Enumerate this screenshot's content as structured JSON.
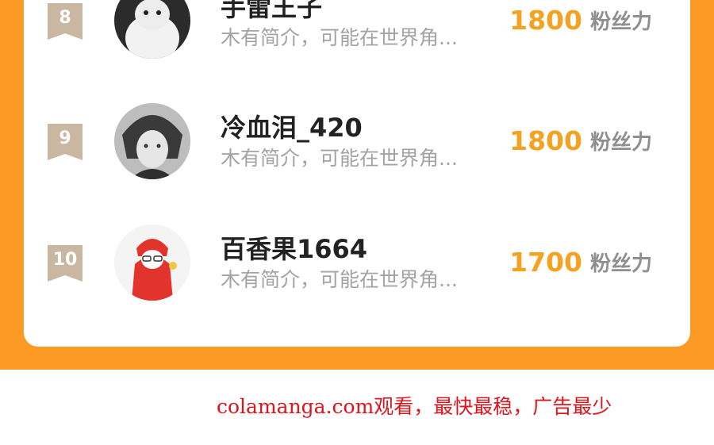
{
  "rows": [
    {
      "rank": "8",
      "username": "手雷王子",
      "bio": "木有简介，可能在世界角...",
      "fans": "1800",
      "fans_unit": "粉丝力"
    },
    {
      "rank": "9",
      "username": "冷血泪_420",
      "bio": "木有简介，可能在世界角...",
      "fans": "1800",
      "fans_unit": "粉丝力"
    },
    {
      "rank": "10",
      "username": "百香果1664",
      "bio": "木有简介，可能在世界角...",
      "fans": "1700",
      "fans_unit": "粉丝力"
    }
  ],
  "watermark": "colamanga.com观看，最快最稳，广告最少",
  "colors": {
    "accent_orange": "#fc9a26",
    "fans_number": "#f3a222",
    "badge": "#c9b7a2",
    "watermark": "#e0141b"
  }
}
